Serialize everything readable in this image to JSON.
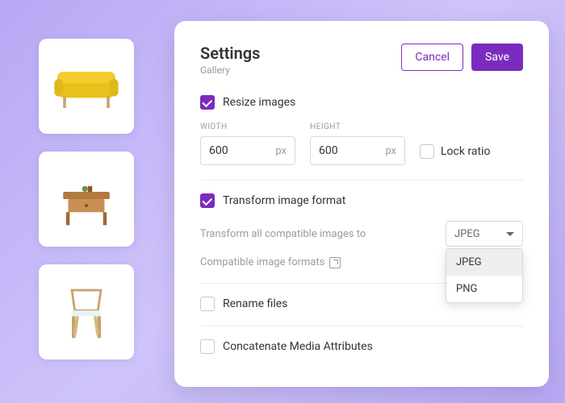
{
  "sidebar": {
    "thumbs": [
      {
        "name": "sofa-thumbnail"
      },
      {
        "name": "side-table-thumbnail"
      },
      {
        "name": "chair-thumbnail"
      }
    ]
  },
  "panel": {
    "title": "Settings",
    "subtitle": "Gallery",
    "cancel": "Cancel",
    "save": "Save"
  },
  "resize": {
    "label": "Resize images",
    "checked": true,
    "width_label": "WIDTH",
    "height_label": "HEIGHT",
    "width": "600",
    "height": "600",
    "unit": "px",
    "lock_ratio": "Lock ratio",
    "lock_checked": false
  },
  "transform": {
    "label": "Transform image format",
    "checked": true,
    "convert_label": "Transform all compatible images to",
    "selected": "JPEG",
    "options": [
      "JPEG",
      "PNG"
    ],
    "compat_label": "Compatible image formats"
  },
  "rename": {
    "label": "Rename files",
    "checked": false
  },
  "concat": {
    "label": "Concatenate Media Attributes",
    "checked": false
  },
  "colors": {
    "accent": "#7b2cbf"
  }
}
